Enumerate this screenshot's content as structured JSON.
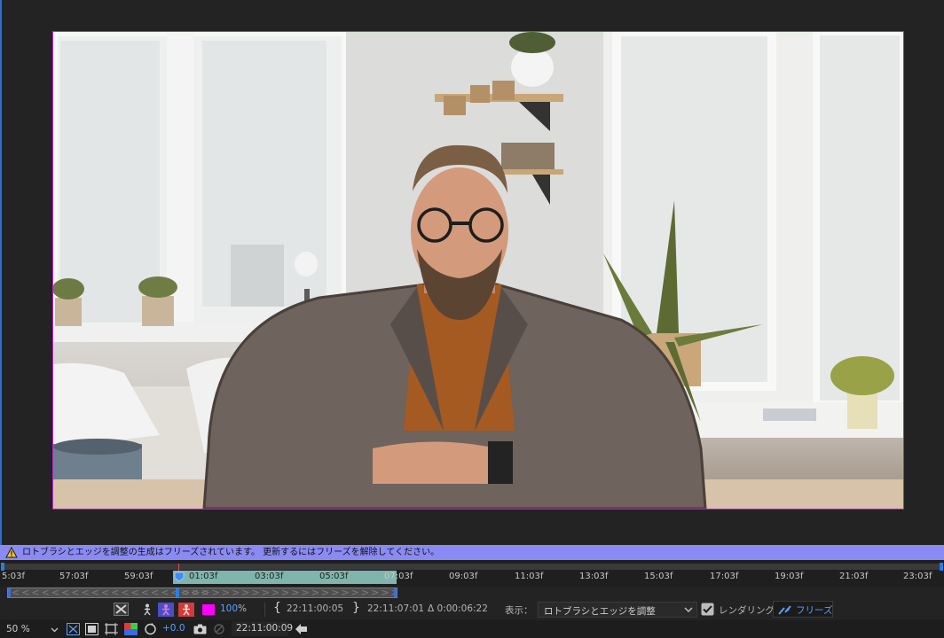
{
  "warning": {
    "text": "ロトブラシとエッジを調整の生成はフリーズされています。 更新するにはフリーズを解除してください。"
  },
  "ruler": {
    "ticks": [
      "5:03f",
      "57:03f",
      "59:03f",
      "01:03f",
      "03:03f",
      "05:03f",
      "07:03f",
      "09:03f",
      "11:03f",
      "13:03f",
      "15:03f",
      "17:03f",
      "19:03f",
      "21:03f",
      "23:03f"
    ]
  },
  "controls": {
    "opacity_value": "100",
    "opacity_unit": "%",
    "in_time": "22:11:00:05",
    "out_time": "22:11:07:01",
    "duration": "Δ 0:00:06:22",
    "view_label": "表示：",
    "view_value": "ロトブラシとエッジを調整",
    "render_label": "レンダリング",
    "freeze_label": "フリーズ"
  },
  "status": {
    "zoom": "50 %",
    "exposure": "+0.0",
    "current_time": "22:11:00:09"
  },
  "colors": {
    "warning_bar": "#8a8af5",
    "work_area": "#7fb5ad",
    "cti_blue": "#2d7de0",
    "frame_border": "#c020d0",
    "mask_color": "#ff00ff"
  }
}
